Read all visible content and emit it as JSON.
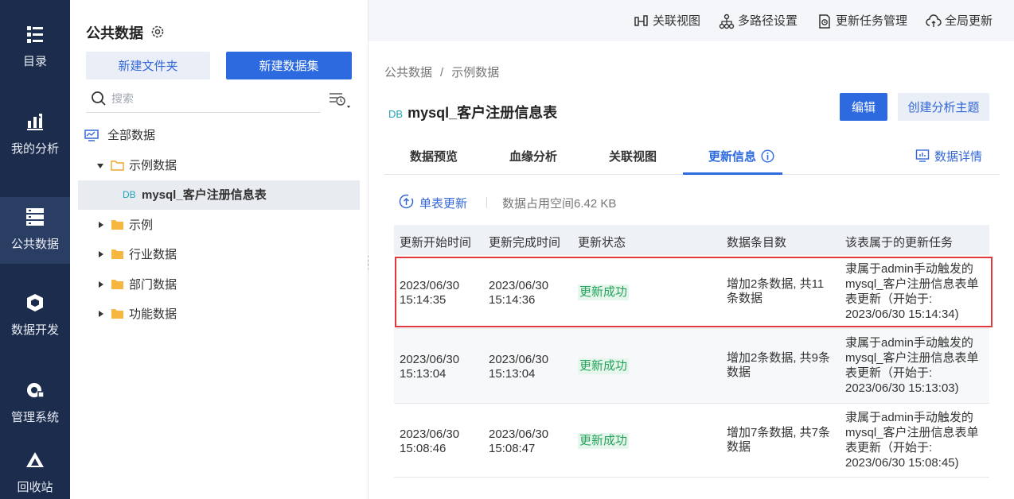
{
  "nav": {
    "items": [
      {
        "label": "目录",
        "icon": "catalog-icon"
      },
      {
        "label": "我的分析",
        "icon": "analysis-icon"
      },
      {
        "label": "公共数据",
        "icon": "public-data-icon"
      },
      {
        "label": "数据开发",
        "icon": "data-dev-icon"
      },
      {
        "label": "管理系统",
        "icon": "admin-system-icon"
      },
      {
        "label": "回收站",
        "icon": "recycle-bin-icon"
      }
    ],
    "active_index": 2
  },
  "sidebar": {
    "title": "公共数据",
    "new_folder_label": "新建文件夹",
    "new_dataset_label": "新建数据集",
    "search_placeholder": "搜索",
    "tree": {
      "root": "全部数据",
      "example_folder": "示例数据",
      "selected_table_tag": "DB",
      "selected_table": "mysql_客户注册信息表",
      "folders": [
        "示例",
        "行业数据",
        "部门数据",
        "功能数据"
      ]
    }
  },
  "topbar": {
    "related_view": "关联视图",
    "multipath": "多路径设置",
    "task_mgmt": "更新任务管理",
    "global_update": "全局更新"
  },
  "breadcrumb": {
    "part1": "公共数据",
    "separator": "/",
    "part2": "示例数据"
  },
  "page": {
    "tag": "DB",
    "title": "mysql_客户注册信息表",
    "edit_label": "编辑",
    "create_topic_label": "创建分析主题"
  },
  "tabs": {
    "preview": "数据预览",
    "lineage": "血缘分析",
    "related": "关联视图",
    "update_info": "更新信息",
    "data_detail": "数据详情"
  },
  "update_bar": {
    "single_update": "单表更新",
    "space_used": "数据占用空间6.42 KB"
  },
  "table": {
    "headers": [
      "更新开始时间",
      "更新完成时间",
      "更新状态",
      "数据条目数",
      "该表属于的更新任务"
    ],
    "rows": [
      {
        "start_date": "2023/06/30",
        "start_time": "15:14:35",
        "end_date": "2023/06/30",
        "end_time": "15:14:36",
        "status": "更新成功",
        "count_l1": "增加2条数据, 共11",
        "count_l2": "条数据",
        "task_l1": "隶属于admin手动触发的",
        "task_l2": "mysql_客户注册信息表单",
        "task_l3": "表更新（开始于:",
        "task_l4": "2023/06/30 15:14:34)"
      },
      {
        "start_date": "2023/06/30",
        "start_time": "15:13:04",
        "end_date": "2023/06/30",
        "end_time": "15:13:04",
        "status": "更新成功",
        "count_l1": "增加2条数据, 共9条",
        "count_l2": "数据",
        "task_l1": "隶属于admin手动触发的",
        "task_l2": "mysql_客户注册信息表单",
        "task_l3": "表更新（开始于:",
        "task_l4": "2023/06/30 15:13:03)"
      },
      {
        "start_date": "2023/06/30",
        "start_time": "15:08:46",
        "end_date": "2023/06/30",
        "end_time": "15:08:47",
        "status": "更新成功",
        "count_l1": "增加7条数据, 共7条",
        "count_l2": "数据",
        "task_l1": "隶属于admin手动触发的",
        "task_l2": "mysql_客户注册信息表单",
        "task_l3": "表更新（开始于:",
        "task_l4": "2023/06/30 15:08:45)"
      }
    ]
  },
  "colors": {
    "accent": "#2d6ae0",
    "nav_bg": "#1c2c4c",
    "success": "#25a35b",
    "highlight": "#e0393e"
  }
}
